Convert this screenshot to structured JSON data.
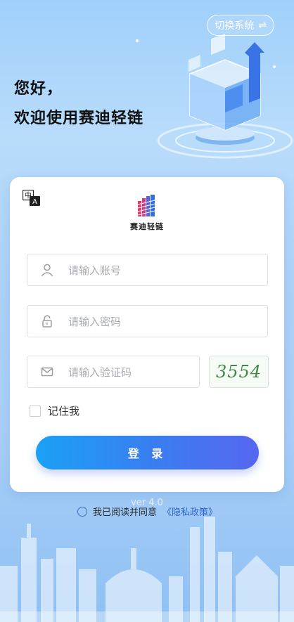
{
  "header": {
    "switch_system_label": "切换系统",
    "switch_icon": "⇌"
  },
  "hero": {
    "greeting": "您好，",
    "welcome": "欢迎使用赛迪轻链"
  },
  "card": {
    "lang_icon": "translate-icon",
    "brand_name": "赛迪轻链",
    "fields": {
      "username_placeholder": "请输入账号",
      "password_placeholder": "请输入密码",
      "captcha_placeholder": "请输入验证码"
    },
    "captcha_value": "3554",
    "remember_label": "记住我",
    "login_label": "登 录"
  },
  "footer": {
    "version": "ver 4.0",
    "agreement_prefix": "我已阅读并同意",
    "policy_link": "《隐私政策》"
  },
  "colors": {
    "accent_start": "#1aa1f5",
    "accent_end": "#5667ef",
    "link": "#2f63c8"
  }
}
